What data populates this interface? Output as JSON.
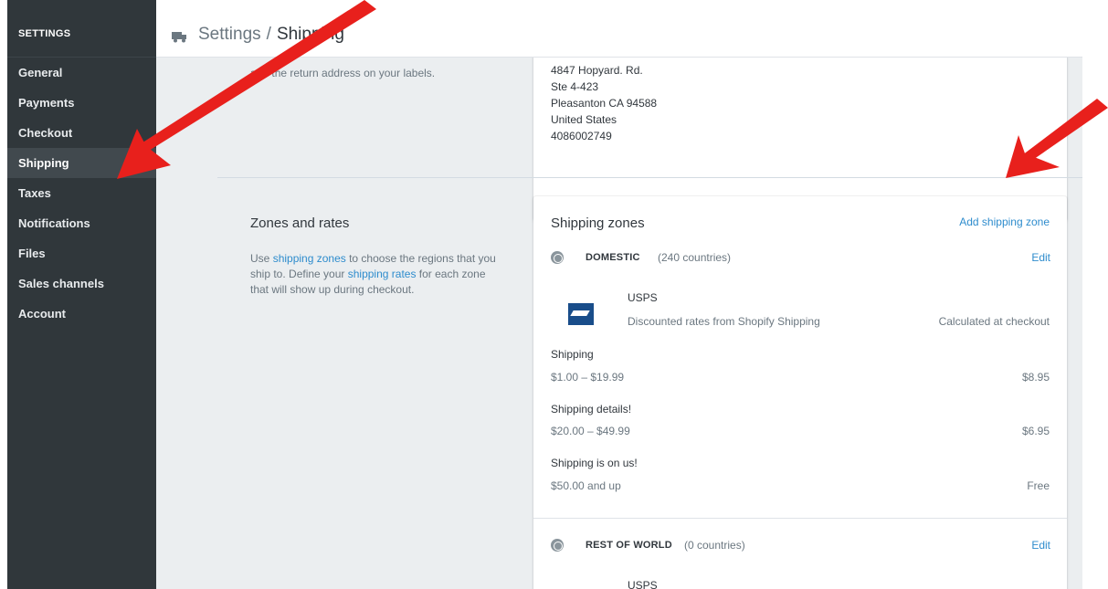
{
  "sidebar": {
    "header": "SETTINGS",
    "items": [
      {
        "label": "General"
      },
      {
        "label": "Payments"
      },
      {
        "label": "Checkout"
      },
      {
        "label": "Shipping"
      },
      {
        "label": "Taxes"
      },
      {
        "label": "Notifications"
      },
      {
        "label": "Files"
      },
      {
        "label": "Sales channels"
      },
      {
        "label": "Account"
      }
    ],
    "active": "Shipping"
  },
  "header": {
    "icon": "truck-icon",
    "parent": "Settings",
    "separator": "/",
    "current": "Shipping"
  },
  "address": {
    "hint": "and the return address on your labels.",
    "lines": [
      "4847 Hopyard. Rd.",
      "Ste 4-423",
      "Pleasanton CA 94588",
      "United States",
      "4086002749"
    ]
  },
  "zones_section": {
    "title": "Zones and rates",
    "desc_1": "Use ",
    "desc_link_1": "shipping zones",
    "desc_2": " to choose the regions that you ship to. Define your ",
    "desc_link_2": "shipping rates",
    "desc_3": " for each zone that will show up during checkout."
  },
  "zones_card": {
    "title": "Shipping zones",
    "add_label": "Add shipping zone",
    "domestic": {
      "name": "DOMESTIC",
      "count": "(240 countries)",
      "edit": "Edit",
      "carrier": "USPS",
      "carrier_sub": "Discounted rates from Shopify Shipping",
      "carrier_rate": "Calculated at checkout",
      "rates": [
        {
          "name": "Shipping",
          "range": "$1.00 – $19.99",
          "price": "$8.95"
        },
        {
          "name": "Shipping details!",
          "range": "$20.00 – $49.99",
          "price": "$6.95"
        },
        {
          "name": "Shipping is on us!",
          "range": "$50.00 and up",
          "price": "Free"
        }
      ]
    },
    "rest": {
      "name": "REST OF WORLD",
      "count": "(0 countries)",
      "edit": "Edit",
      "carrier": "USPS"
    }
  },
  "colors": {
    "sidebar_bg": "#30373b",
    "link": "#2e8ccd",
    "arrow": "#e8201c"
  }
}
